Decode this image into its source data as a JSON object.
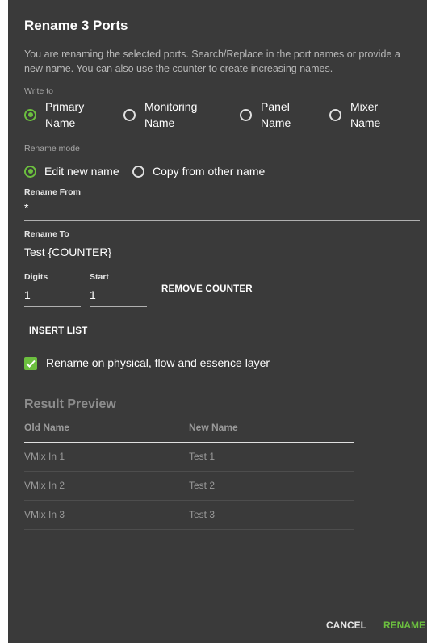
{
  "dialog": {
    "title": "Rename 3 Ports",
    "description": "You are renaming the selected ports. Search/Replace in the port names or provide a new name. You can also use the counter to create increasing names."
  },
  "write_to": {
    "label": "Write to",
    "options": [
      {
        "line1": "Primary",
        "line2": "Name",
        "selected": true
      },
      {
        "line1": "Monitoring",
        "line2": "Name",
        "selected": false
      },
      {
        "line1": "Panel",
        "line2": "Name",
        "selected": false
      },
      {
        "line1": "Mixer",
        "line2": "Name",
        "selected": false
      }
    ]
  },
  "rename_mode": {
    "label": "Rename mode",
    "options": [
      {
        "label": "Edit new name",
        "selected": true
      },
      {
        "label": "Copy from other name",
        "selected": false
      }
    ]
  },
  "rename_from": {
    "label": "Rename From",
    "value": "*"
  },
  "rename_to": {
    "label": "Rename To",
    "value": "Test {COUNTER}"
  },
  "counter": {
    "digits_label": "Digits",
    "digits_value": "1",
    "start_label": "Start",
    "start_value": "1",
    "remove_label": "REMOVE COUNTER"
  },
  "insert_list_label": "INSERT LIST",
  "layer_checkbox": {
    "label": "Rename on physical, flow and essence layer",
    "checked": true
  },
  "preview": {
    "title": "Result Preview",
    "columns": [
      "Old Name",
      "New Name"
    ],
    "rows": [
      {
        "old": "VMix In 1",
        "new": "Test 1"
      },
      {
        "old": "VMix In 2",
        "new": "Test 2"
      },
      {
        "old": "VMix In 3",
        "new": "Test 3"
      }
    ]
  },
  "footer": {
    "cancel": "CANCEL",
    "rename": "RENAME"
  },
  "colors": {
    "dialog_bg": "#3a3a3a",
    "accent_green": "#6cbf3f",
    "muted_text": "#9a9a9a"
  }
}
